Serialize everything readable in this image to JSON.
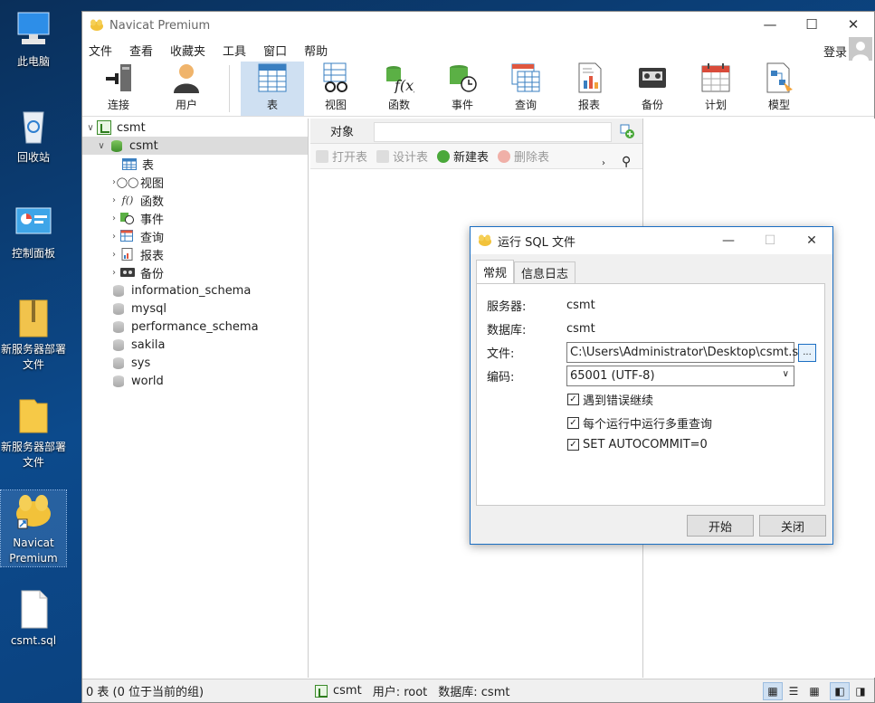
{
  "desktop": {
    "icons": [
      {
        "label": "此电脑",
        "icon": "computer-icon"
      },
      {
        "label": "回收站",
        "icon": "recycle-bin-icon"
      },
      {
        "label": "控制面板",
        "icon": "control-panel-icon"
      },
      {
        "label": "新服务器部署文件",
        "icon": "zip-folder-icon"
      },
      {
        "label": "新服务器部署文件",
        "icon": "folder-icon"
      },
      {
        "label": "Navicat Premium",
        "icon": "navicat-icon"
      },
      {
        "label": "csmt.sql",
        "icon": "file-icon"
      }
    ]
  },
  "app": {
    "title": "Navicat Premium",
    "login": "登录",
    "menu": [
      "文件",
      "查看",
      "收藏夹",
      "工具",
      "窗口",
      "帮助"
    ],
    "toolbar": [
      {
        "label": "连接",
        "icon": "connection-icon"
      },
      {
        "label": "用户",
        "icon": "user-icon"
      },
      {
        "label": "表",
        "icon": "table-icon",
        "active": true
      },
      {
        "label": "视图",
        "icon": "view-icon"
      },
      {
        "label": "函数",
        "icon": "function-icon"
      },
      {
        "label": "事件",
        "icon": "event-icon"
      },
      {
        "label": "查询",
        "icon": "query-icon"
      },
      {
        "label": "报表",
        "icon": "report-icon"
      },
      {
        "label": "备份",
        "icon": "backup-icon"
      },
      {
        "label": "计划",
        "icon": "schedule-icon"
      },
      {
        "label": "模型",
        "icon": "model-icon"
      }
    ]
  },
  "tree": {
    "connection": "csmt",
    "active_db": "csmt",
    "children": [
      "表",
      "视图",
      "函数",
      "事件",
      "查询",
      "报表",
      "备份"
    ],
    "databases": [
      "information_schema",
      "mysql",
      "performance_schema",
      "sakila",
      "sys",
      "world"
    ]
  },
  "objects": {
    "tab": "对象",
    "tools": [
      "打开表",
      "设计表",
      "新建表",
      "删除表"
    ]
  },
  "status": {
    "left": "0 表 (0 位于当前的组)",
    "connection": "csmt",
    "user": "用户: root",
    "database": "数据库: csmt"
  },
  "dialog": {
    "title": "运行 SQL 文件",
    "tabs": [
      "常规",
      "信息日志"
    ],
    "server_label": "服务器:",
    "server_value": "csmt",
    "db_label": "数据库:",
    "db_value": "csmt",
    "file_label": "文件:",
    "file_value": "C:\\Users\\Administrator\\Desktop\\csmt.sql",
    "browse_label": "...",
    "encoding_label": "编码:",
    "encoding_value": "65001 (UTF-8)",
    "options": [
      {
        "label": "遇到错误继续",
        "checked": true
      },
      {
        "label": "每个运行中运行多重查询",
        "checked": true
      },
      {
        "label": "SET AUTOCOMMIT=0",
        "checked": true
      }
    ],
    "start_button": "开始",
    "close_button": "关闭"
  },
  "colors": {
    "accent": "#1b6ec2",
    "selected_tab": "#cfe0f2",
    "navicat_yellow": "#f2c23a"
  }
}
